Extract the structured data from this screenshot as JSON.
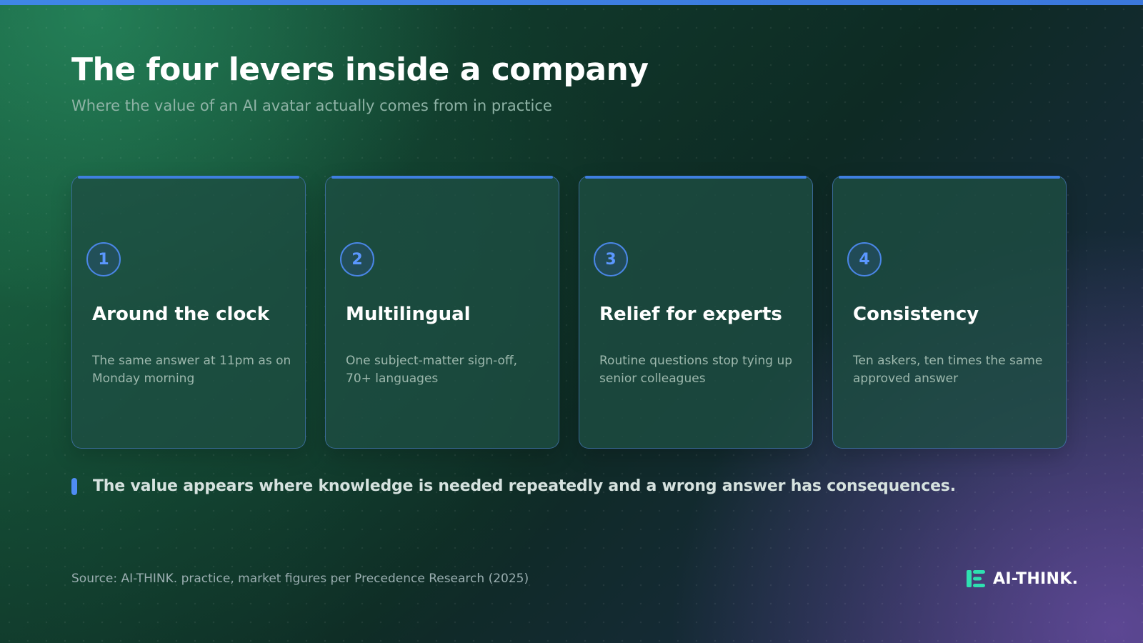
{
  "slide": {
    "title": "The four levers inside a company",
    "subtitle": "Where the value of an AI avatar actually comes from in practice"
  },
  "cards": [
    {
      "number": "1",
      "title": "Around the clock",
      "description": "The same answer at 11pm as on Monday morning"
    },
    {
      "number": "2",
      "title": "Multilingual",
      "description": "One subject-matter sign-off, 70+ languages"
    },
    {
      "number": "3",
      "title": "Relief for experts",
      "description": "Routine questions stop tying up senior colleagues"
    },
    {
      "number": "4",
      "title": "Consistency",
      "description": "Ten askers, ten times the same approved answer"
    }
  ],
  "takeaway": "The value appears where knowledge is needed repeatedly and a wrong answer has consequences.",
  "footer": {
    "source": "Source: AI-THINK. practice, market figures per Precedence Research (2025)",
    "logo_text": "AI-THINK."
  },
  "colors": {
    "accent": "#3f7fe0",
    "logo_icon": "#2ee0b0"
  },
  "icons": {
    "logo": "ai-think-logo-icon"
  }
}
